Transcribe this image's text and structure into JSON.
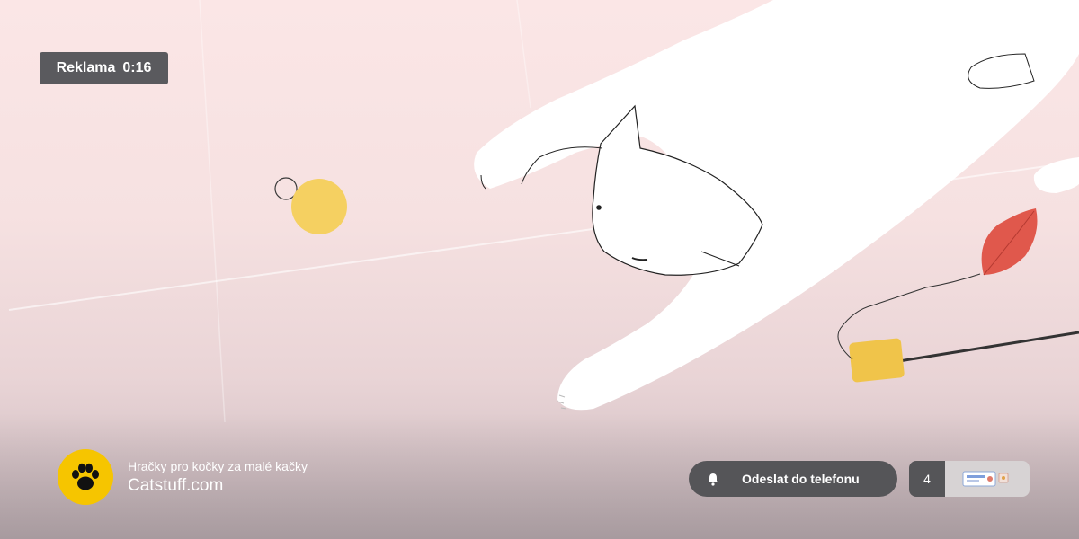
{
  "ad_badge": {
    "label": "Reklama",
    "time": "0:16"
  },
  "advertiser": {
    "tagline": "Hračky pro kočky za malé kačky",
    "domain": "Catstuff.com",
    "logo_icon": "paw-icon",
    "logo_color": "#f6c500"
  },
  "send_button": {
    "label": "Odeslat do telefonu",
    "icon": "bell-icon"
  },
  "queue": {
    "count": "4",
    "thumbnail_icon": "video-thumbnail-icon"
  },
  "colors": {
    "badge_bg": "#5a5a5e",
    "button_bg": "#555558",
    "ball": "#f5d061",
    "leaf": "#e0584c",
    "toy_block": "#f0c44a"
  }
}
